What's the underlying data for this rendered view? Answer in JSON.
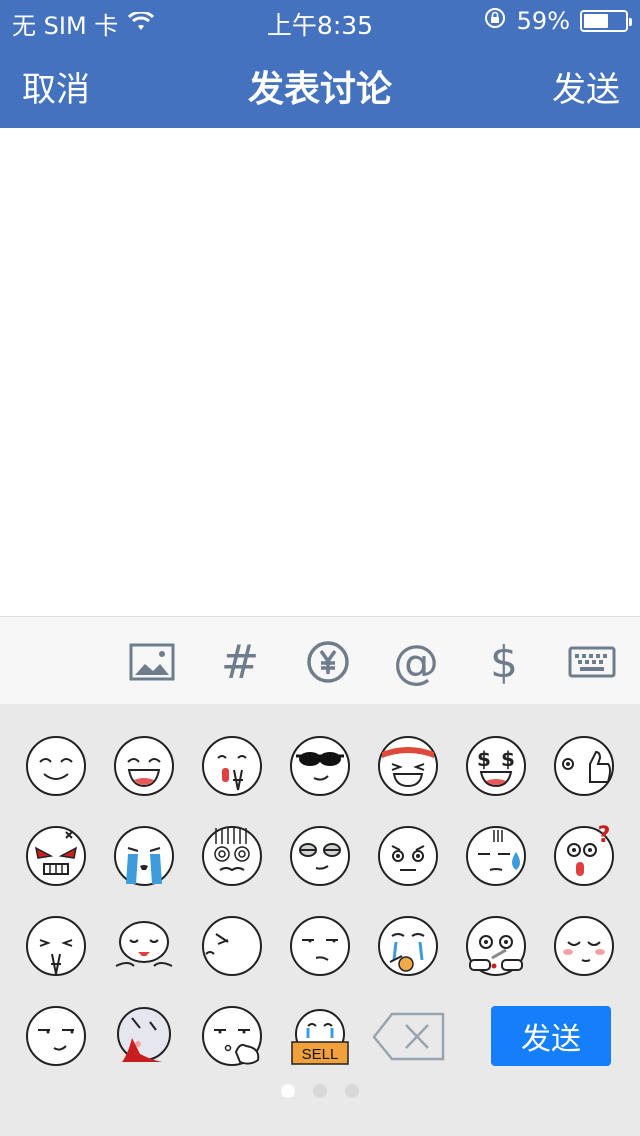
{
  "status_bar": {
    "carrier": "无 SIM 卡",
    "time": "上午8:35",
    "battery_percent_text": "59%",
    "battery_level": 0.59,
    "icons": [
      "wifi-icon",
      "orientation-lock-icon",
      "battery-icon"
    ]
  },
  "nav": {
    "cancel_label": "取消",
    "title": "发表讨论",
    "send_label": "发送"
  },
  "compose": {
    "placeholder": ""
  },
  "toolbar": {
    "items": [
      "image-icon",
      "hashtag-icon",
      "yen-coin-icon",
      "at-icon",
      "dollar-icon",
      "keyboard-icon"
    ],
    "hash_glyph": "#",
    "at_glyph": "@",
    "dollar_glyph": "$"
  },
  "emoji_panel": {
    "emojis": [
      "smile",
      "laugh",
      "pray-cry",
      "sunglasses",
      "headband-grin",
      "money-eyes",
      "thumbs-up",
      "angry",
      "crying",
      "dizzy",
      "smug",
      "sad",
      "sweat",
      "surprised-question",
      "grin-pray",
      "bow",
      "lean-look",
      "speechless",
      "cry-eat",
      "cry-knife",
      "shy",
      "sly",
      "bloody",
      "thinking",
      "sell"
    ],
    "sell_label": "SELL",
    "send_label": "发送",
    "page_count": 3,
    "active_page": 1
  },
  "colors": {
    "header": "#4572bf",
    "send_button": "#147efb",
    "toolbar_icon": "#6e7c8c"
  }
}
